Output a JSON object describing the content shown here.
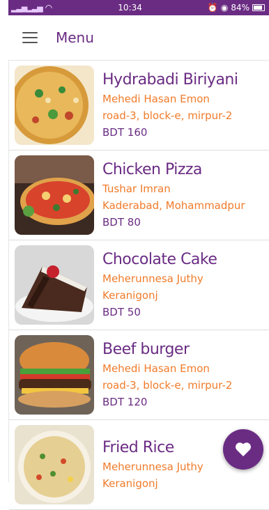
{
  "status": {
    "time": "10:34",
    "battery": "84%"
  },
  "appbar": {
    "title": "Menu"
  },
  "items": [
    {
      "name": "Hydrabadi Biriyani",
      "seller": "Mehedi Hasan Emon",
      "address": "road-3, block-e, mirpur-2",
      "price": "BDT  160"
    },
    {
      "name": "Chicken Pizza",
      "seller": "Tushar Imran",
      "address": "Kaderabad, Mohammadpur",
      "price": "BDT  80"
    },
    {
      "name": "Chocolate Cake",
      "seller": "Meherunnesa Juthy",
      "address": "Keranigonj",
      "price": "BDT  50"
    },
    {
      "name": "Beef burger",
      "seller": "Mehedi Hasan Emon",
      "address": "road-3, block-e, mirpur-2",
      "price": "BDT  120"
    },
    {
      "name": "Fried Rice",
      "seller": "Meherunnesa Juthy",
      "address": "Keranigonj",
      "price": ""
    }
  ],
  "colors": {
    "primary": "#6a2c83",
    "accent": "#f07b2a"
  },
  "icons": {
    "menu": "hamburger-icon",
    "fab": "heart-icon"
  }
}
